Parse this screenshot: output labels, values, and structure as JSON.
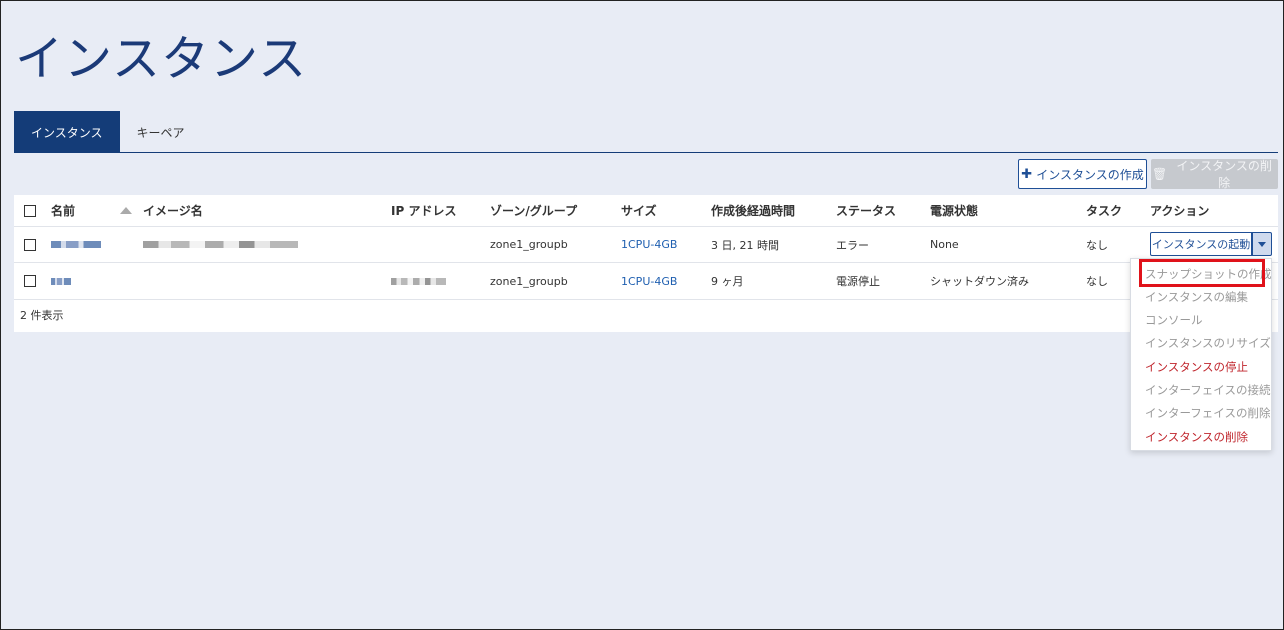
{
  "page": {
    "title": "インスタンス"
  },
  "tabs": [
    {
      "label": "インスタンス",
      "active": true
    },
    {
      "label": "キーペア",
      "active": false
    }
  ],
  "toolbar": {
    "create_label": "インスタンスの作成",
    "delete_label": "インスタンスの削除"
  },
  "table": {
    "columns": [
      "名前",
      "イメージ名",
      "IP アドレス",
      "ゾーン/グループ",
      "サイズ",
      "作成後経過時間",
      "ステータス",
      "電源状態",
      "タスク",
      "アクション"
    ],
    "rows": [
      {
        "zone": "zone1_groupb",
        "size": "1CPU-4GB",
        "age": "3 日, 21 時間",
        "status": "エラー",
        "power": "None",
        "task": "なし",
        "action": "インスタンスの起動"
      },
      {
        "zone": "zone1_groupb",
        "size": "1CPU-4GB",
        "age": "9 ヶ月",
        "status": "電源停止",
        "power": "シャットダウン済み",
        "task": "なし"
      }
    ],
    "footer": "2 件表示"
  },
  "menu": {
    "items": [
      {
        "label": "スナップショットの作成",
        "danger": false
      },
      {
        "label": "インスタンスの編集",
        "danger": false
      },
      {
        "label": "コンソール",
        "danger": false
      },
      {
        "label": "インスタンスのリサイズ",
        "danger": false
      },
      {
        "label": "インスタンスの停止",
        "danger": true
      },
      {
        "label": "インターフェイスの接続",
        "danger": false
      },
      {
        "label": "インターフェイスの削除",
        "danger": false
      },
      {
        "label": "インスタンスの削除",
        "danger": true
      }
    ]
  },
  "colors": {
    "primary": "#143c78",
    "link": "#1f5fb0",
    "danger": "#c0262d",
    "highlight": "#e0121a",
    "background": "#e8ecf5"
  }
}
